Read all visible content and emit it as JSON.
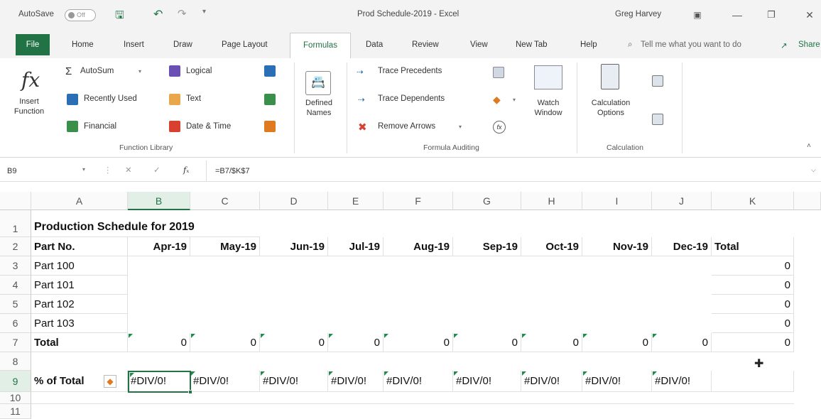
{
  "titlebar": {
    "autosave_label": "AutoSave",
    "autosave_state": "Off",
    "doc_title": "Prod Schedule-2019  -  Excel",
    "user": "Greg Harvey"
  },
  "tabs": [
    "File",
    "Home",
    "Insert",
    "Draw",
    "Page Layout",
    "Formulas",
    "Data",
    "Review",
    "View",
    "New Tab",
    "Help"
  ],
  "tell_me": "Tell me what you want to do",
  "share": "Share",
  "ribbon": {
    "insert_function": [
      "Insert",
      "Function"
    ],
    "autosum": "AutoSum",
    "recently_used": "Recently Used",
    "financial": "Financial",
    "logical": "Logical",
    "text": "Text",
    "date_time": "Date & Time",
    "defined_names": [
      "Defined",
      "Names"
    ],
    "trace_precedents": "Trace Precedents",
    "trace_dependents": "Trace Dependents",
    "remove_arrows": "Remove Arrows",
    "watch_window": [
      "Watch",
      "Window"
    ],
    "calc_options": [
      "Calculation",
      "Options"
    ],
    "group_function_library": "Function Library",
    "group_formula_auditing": "Formula Auditing",
    "group_calculation": "Calculation"
  },
  "formula_bar": {
    "name_box": "B9",
    "formula": "=B7/$K$7"
  },
  "sheet": {
    "columns": [
      "A",
      "B",
      "C",
      "D",
      "E",
      "F",
      "G",
      "H",
      "I",
      "J",
      "K"
    ],
    "rows": [
      "1",
      "2",
      "3",
      "4",
      "5",
      "6",
      "7",
      "8",
      "9",
      "10",
      "11"
    ],
    "title": "Production Schedule for 2019",
    "header_label": "Part No.",
    "months": [
      "Apr-19",
      "May-19",
      "Jun-19",
      "Jul-19",
      "Aug-19",
      "Sep-19",
      "Oct-19",
      "Nov-19",
      "Dec-19"
    ],
    "total_header": "Total",
    "parts": [
      "Part 100",
      "Part 101",
      "Part 102",
      "Part 103"
    ],
    "part_totals": [
      "0",
      "0",
      "0",
      "0"
    ],
    "total_label": "Total",
    "total_values": [
      "0",
      "0",
      "0",
      "0",
      "0",
      "0",
      "0",
      "0",
      "0"
    ],
    "grand_total": "0",
    "pct_label": "% of Total",
    "pct_values": [
      "#DIV/0!",
      "#DIV/0!",
      "#DIV/0!",
      "#DIV/0!",
      "#DIV/0!",
      "#DIV/0!",
      "#DIV/0!",
      "#DIV/0!",
      "#DIV/0!"
    ]
  }
}
